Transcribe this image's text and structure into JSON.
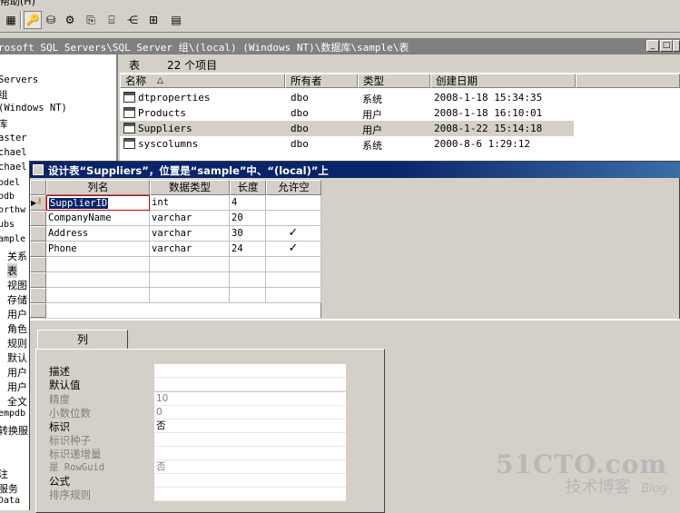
{
  "menu": {
    "partial": "帮助(H)"
  },
  "window": {
    "title": "rosoft SQL Servers\\SQL Server 组\\(local) (Windows NT)\\数据库\\sample\\表",
    "min": "_",
    "max": "□",
    "close": "×"
  },
  "tree": {
    "items": [
      "Servers",
      "组",
      "(Windows NT)",
      "库",
      "aster",
      "chael",
      "chael",
      "odel",
      "odb",
      "orthw",
      "ubs",
      "ample",
      "关系",
      "表",
      "视图",
      "存储",
      "用户",
      "角色",
      "规则",
      "默认",
      "用户",
      "用户",
      "全文",
      "empdb",
      "转换服",
      "注",
      "服务",
      "Data"
    ]
  },
  "list": {
    "label": "表",
    "count": "22 个项目",
    "columns": [
      "名称",
      "所有者",
      "类型",
      "创建日期"
    ],
    "sort_arrow": "△",
    "rows": [
      {
        "name": "dtproperties",
        "owner": "dbo",
        "type": "系统",
        "date": "2008-1-18 15:34:35"
      },
      {
        "name": "Products",
        "owner": "dbo",
        "type": "用户",
        "date": "2008-1-18 16:10:01"
      },
      {
        "name": "Suppliers",
        "owner": "dbo",
        "type": "用户",
        "date": "2008-1-22 15:14:18"
      },
      {
        "name": "syscolumns",
        "owner": "dbo",
        "type": "系统",
        "date": "2000-8-6 1:29:12"
      }
    ]
  },
  "dialog": {
    "title": "设计表“Suppliers”，位置是“sample”中、“(local)”上",
    "columns": [
      "列名",
      "数据类型",
      "长度",
      "允许空"
    ],
    "rows": [
      {
        "name": "SupplierID",
        "type": "int",
        "length": "4",
        "nullable": ""
      },
      {
        "name": "CompanyName",
        "type": "varchar",
        "length": "20",
        "nullable": ""
      },
      {
        "name": "Address",
        "type": "varchar",
        "length": "30",
        "nullable": "✓"
      },
      {
        "name": "Phone",
        "type": "varchar",
        "length": "24",
        "nullable": "✓"
      }
    ],
    "key_icon": "key-icon"
  },
  "props": {
    "tab": "列",
    "fields": [
      {
        "label": "描述",
        "value": "",
        "disabled": false
      },
      {
        "label": "默认值",
        "value": "",
        "disabled": false
      },
      {
        "label": "精度",
        "value": "10",
        "disabled": true
      },
      {
        "label": "小数位数",
        "value": "0",
        "disabled": true
      },
      {
        "label": "标识",
        "value": "否",
        "disabled": false
      },
      {
        "label": "标识种子",
        "value": "",
        "disabled": true
      },
      {
        "label": "标识递增量",
        "value": "",
        "disabled": true
      },
      {
        "label": "是 RowGuid",
        "value": "否",
        "disabled": true
      },
      {
        "label": "公式",
        "value": "",
        "disabled": false
      },
      {
        "label": "排序规则",
        "value": "",
        "disabled": true
      }
    ]
  },
  "watermark": {
    "line1": "51CTO.com",
    "line2": "技术博客",
    "line3": "Blog"
  },
  "colors": {
    "highlight": "#cc0000",
    "title_active": "#0a246a",
    "title_inactive": "#808080"
  }
}
